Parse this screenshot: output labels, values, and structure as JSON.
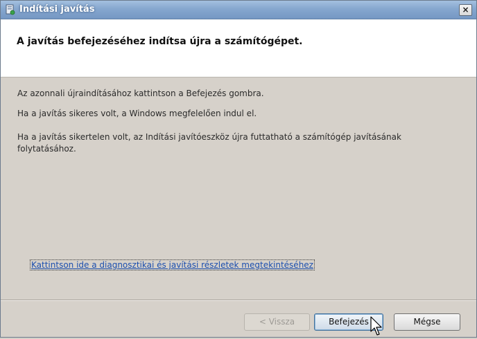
{
  "window": {
    "title": "Indítási javítás",
    "close_glyph": "×",
    "app_icon": "startup-repair-icon"
  },
  "header": {
    "title": "A javítás befejezéséhez indítsa újra a számítógépet."
  },
  "content": {
    "messages": [
      "Az azonnali újraindításához kattintson a Befejezés gombra.",
      "Ha a javítás sikeres volt, a Windows megfelelően indul el.",
      "Ha a javítás sikertelen volt, az Indítási javítóeszköz újra futtatható a számítógép javításának folytatásához."
    ],
    "details_link": "Kattintson ide a diagnosztikai és javítási részletek megtekintéséhez"
  },
  "buttons": {
    "back": "< Vissza",
    "finish": "Befejezés",
    "cancel": "Mégse"
  },
  "colors": {
    "titlebar": "#86a7cf",
    "link": "#1c4fae",
    "dialog_bg": "#d6d1ca"
  }
}
